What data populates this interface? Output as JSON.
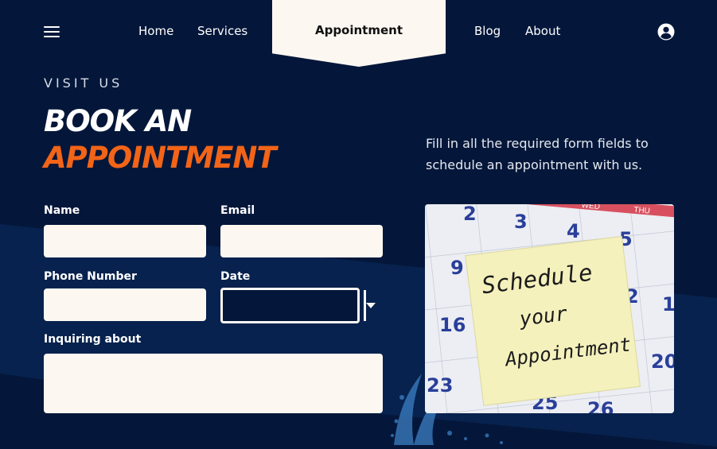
{
  "nav": {
    "menu_icon": "hamburger-icon",
    "items": [
      {
        "label": "Home"
      },
      {
        "label": "Services"
      },
      {
        "label": "Appointment",
        "active": true
      },
      {
        "label": "Blog"
      },
      {
        "label": "About"
      }
    ],
    "user_icon": "user-circle-icon"
  },
  "hero": {
    "eyebrow": "VISIT US",
    "title_line1": "BOOK AN",
    "title_line2": "APPOINTMENT",
    "description": "Fill in all the required form fields to schedule an appointment with us."
  },
  "form": {
    "name_label": "Name",
    "email_label": "Email",
    "phone_label": "Phone Number",
    "date_label": "Date",
    "inquiry_label": "Inquiring about",
    "name_value": "",
    "email_value": "",
    "phone_value": "",
    "date_value": "",
    "inquiry_value": ""
  },
  "image": {
    "note_line1": "Schedule",
    "note_line2": "your",
    "note_line3": "Appointment",
    "day_wed": "WED",
    "day_thu": "THU",
    "cal_numbers": [
      "2",
      "3",
      "4",
      "5",
      "9",
      "2",
      "1",
      "16",
      "20",
      "23",
      "25",
      "26"
    ]
  },
  "colors": {
    "background": "#04173a",
    "accent": "#f26417",
    "field": "#fdf7f2"
  }
}
